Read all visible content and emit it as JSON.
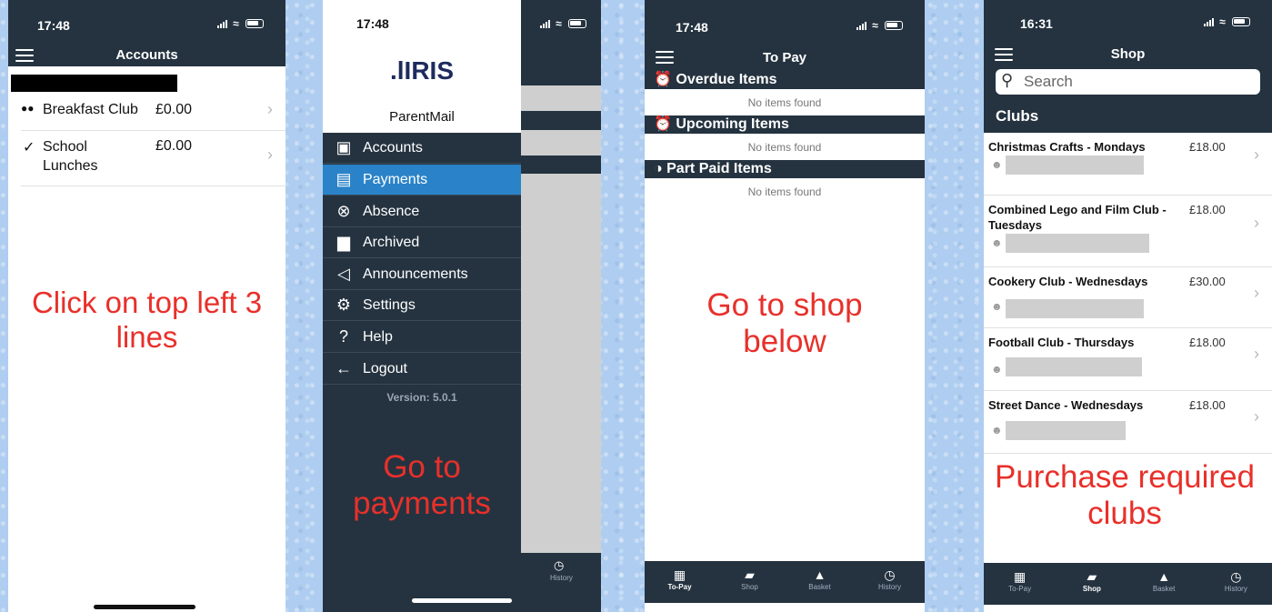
{
  "phone1": {
    "time": "17:48",
    "title": "Accounts",
    "rows": [
      {
        "icon": "people-icon",
        "glyph": "♦",
        "name": "Breakfast Club",
        "amount": "£0.00"
      },
      {
        "icon": "check-icon",
        "glyph": "✓",
        "name": "School Lunches",
        "amount": "£0.00"
      }
    ],
    "annotation": "Click on top left 3 lines"
  },
  "phone2": {
    "time": "17:48",
    "brand": ".lIRIS",
    "app_name": "ParentMail",
    "menu": [
      {
        "label": "Accounts",
        "icon": "briefcase-icon",
        "active": false
      },
      {
        "label": "Payments",
        "icon": "card-icon",
        "active": true
      },
      {
        "label": "Absence",
        "icon": "circle-x-icon",
        "active": false
      },
      {
        "label": "Archived",
        "icon": "trash-icon",
        "active": false
      },
      {
        "label": "Announcements",
        "icon": "megaphone-icon",
        "active": false
      },
      {
        "label": "Settings",
        "icon": "gear-icon",
        "active": false
      },
      {
        "label": "Help",
        "icon": "question-icon",
        "active": false
      },
      {
        "label": "Logout",
        "icon": "arrow-left-icon",
        "active": false
      }
    ],
    "version": "Version: 5.0.1",
    "history_label": "History",
    "annotation": "Go to payments"
  },
  "phone3": {
    "time": "17:48",
    "title": "To Pay",
    "sections": [
      {
        "title": "Overdue Items",
        "icon": "alarm-icon",
        "empty": "No items found"
      },
      {
        "title": "Upcoming Items",
        "icon": "alarm-icon",
        "empty": "No items found"
      },
      {
        "title": "Part Paid Items",
        "icon": "half-circle-icon",
        "empty": "No items found"
      }
    ],
    "annotation": "Go to shop below",
    "tabs": [
      {
        "label": "To-Pay",
        "icon": "calendar-icon",
        "active": true
      },
      {
        "label": "Shop",
        "icon": "cart-icon",
        "active": false
      },
      {
        "label": "Basket",
        "icon": "basket-icon",
        "active": false
      },
      {
        "label": "History",
        "icon": "clock-icon",
        "active": false
      }
    ]
  },
  "phone4": {
    "time": "16:31",
    "title": "Shop",
    "search_placeholder": "Search",
    "section": "Clubs",
    "items": [
      {
        "name": "Christmas Crafts - Mondays",
        "price": "£18.00"
      },
      {
        "name": "Combined Lego and Film Club - Tuesdays",
        "price": "£18.00"
      },
      {
        "name": "Cookery Club - Wednesdays",
        "price": "£30.00"
      },
      {
        "name": "Football Club - Thursdays",
        "price": "£18.00"
      },
      {
        "name": "Street Dance - Wednesdays",
        "price": "£18.00"
      }
    ],
    "annotation": "Purchase required clubs",
    "tabs": [
      {
        "label": "To-Pay",
        "icon": "calendar-icon",
        "active": false
      },
      {
        "label": "Shop",
        "icon": "cart-icon",
        "active": true
      },
      {
        "label": "Basket",
        "icon": "basket-icon",
        "active": false
      },
      {
        "label": "History",
        "icon": "clock-icon",
        "active": false
      }
    ]
  }
}
